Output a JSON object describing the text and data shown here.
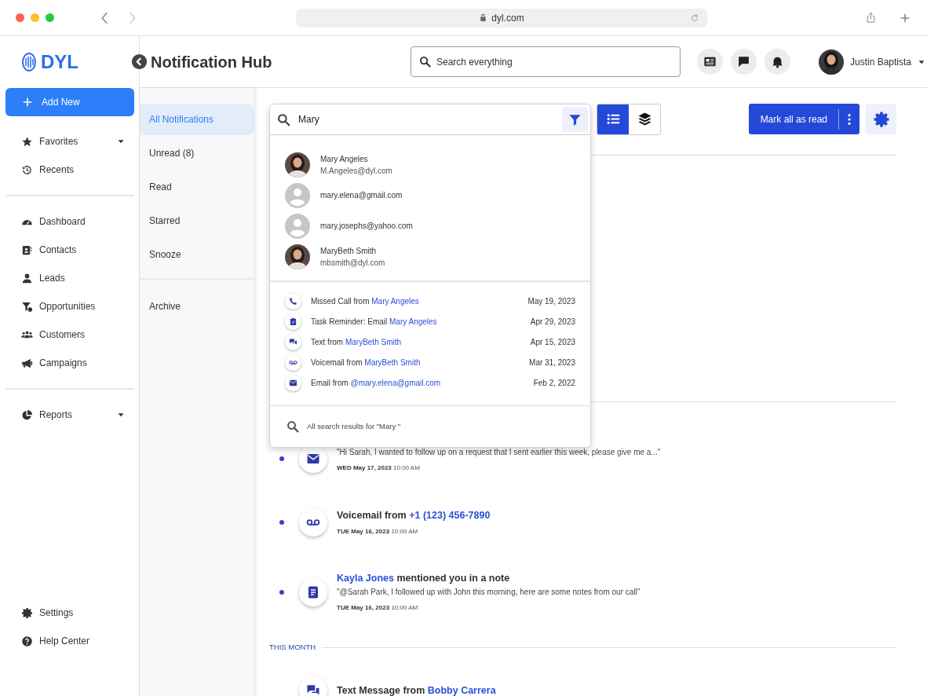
{
  "browser": {
    "url": "dyl.com"
  },
  "app": {
    "logo": "DYL",
    "page_title": "Notification Hub",
    "search": {
      "placeholder": "Search everything"
    },
    "user": {
      "name": "Justin Baptista"
    }
  },
  "sidebar": {
    "add_new": "Add New",
    "groups": [
      [
        {
          "label": "Favorites",
          "expandable": true
        },
        {
          "label": "Recents",
          "expandable": false
        }
      ],
      [
        {
          "label": "Dashboard",
          "expandable": false
        },
        {
          "label": "Contacts",
          "expandable": false
        },
        {
          "label": "Leads",
          "expandable": false
        },
        {
          "label": "Opportunities",
          "expandable": false
        },
        {
          "label": "Customers",
          "expandable": false
        },
        {
          "label": "Campaigns",
          "expandable": false
        }
      ],
      [
        {
          "label": "Reports",
          "expandable": true
        }
      ]
    ],
    "footer": [
      {
        "label": "Settings"
      },
      {
        "label": "Help Center"
      }
    ]
  },
  "filters": [
    [
      {
        "label": "All Notifications",
        "selected": true
      },
      {
        "label": "Unread (8)",
        "selected": false
      },
      {
        "label": "Read",
        "selected": false
      },
      {
        "label": "Starred",
        "selected": false
      },
      {
        "label": "Snooze",
        "selected": false
      }
    ],
    [
      {
        "label": "Archive",
        "selected": false
      }
    ]
  ],
  "toolbar": {
    "views": [
      {
        "kind": "list",
        "selected": true
      },
      {
        "kind": "stacked",
        "selected": false
      }
    ],
    "mark_all": "Mark all as read"
  },
  "search_dropdown": {
    "value": "Mary",
    "contacts": [
      {
        "name": "Mary Angeles",
        "email": "M.Angeles@dyl.com"
      },
      {
        "kind": "placeholder",
        "email": "mary.elena@gmail.com"
      },
      {
        "kind": "placeholder",
        "email": "mary.josephs@yahoo.com"
      },
      {
        "name": "MaryBeth Smith",
        "email": "mbsmith@dyl.com"
      }
    ],
    "recent": [
      {
        "kind": "call",
        "text": "Missed Call from ",
        "link": "Mary Angeles",
        "date": "May 19, 2023"
      },
      {
        "kind": "task",
        "text": "Task Reminder: Email ",
        "link": "Mary Angeles",
        "date": "Apr 29, 2023"
      },
      {
        "kind": "text",
        "text": "Text from ",
        "link": "MaryBeth Smith",
        "date": "Apr 15, 2023"
      },
      {
        "kind": "voicemail",
        "text": "Voicemail from ",
        "link": "MaryBeth Smith",
        "date": "Mar 31, 2023"
      },
      {
        "kind": "email",
        "text": "Email from ",
        "link": "@mary.elena@gmail.com",
        "date": "Feb 2, 2022"
      }
    ],
    "all_results": "All search results for \"Mary \""
  },
  "notifications": [
    {
      "kind": "email",
      "unread": true,
      "preview": "\"Hi Sarah, I wanted to follow up on a request that I sent earlier this week, please give me a...\"",
      "date": "**WED May 17, 2023** 10:00 AM"
    },
    {
      "kind": "voicemail",
      "unread": true,
      "title": [
        {
          "text": "Voicemail from ",
          "link": false
        },
        {
          "text": "+1 (123) 456-7890",
          "link": true
        }
      ],
      "date": "**TUE May 16, 2023** 10:00 AM"
    },
    {
      "kind": "note",
      "unread": true,
      "title": [
        {
          "text": "Kayla Jones",
          "link": true
        },
        {
          "text": " mentioned you in a note",
          "link": false
        }
      ],
      "preview": "\"@Sarah Park, I followed up with John this morning, here are some notes from our call\"",
      "date": "**TUE May 16, 2023** 10:00 AM"
    },
    {
      "kind": "section",
      "label": "THIS MONTH"
    },
    {
      "kind": "text",
      "unread": false,
      "title": [
        {
          "text": "Text Message from ",
          "link": false
        },
        {
          "text": "Bobby Carrera",
          "link": true
        }
      ]
    }
  ]
}
